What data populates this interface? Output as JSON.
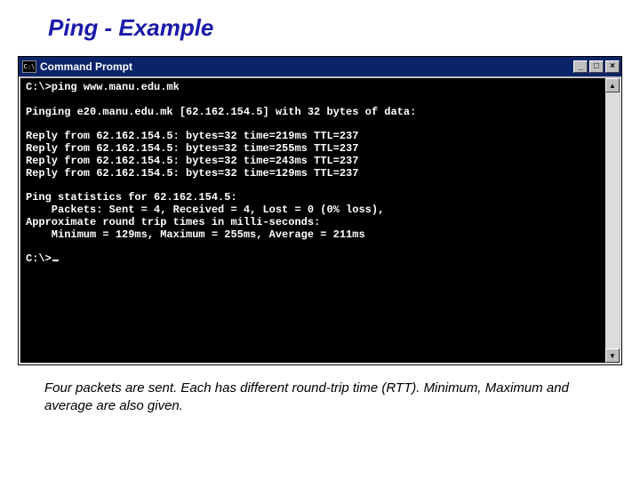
{
  "slide": {
    "title": "Ping - Example",
    "caption": "Four packets are sent. Each has different round-trip time (RTT). Minimum, Maximum and average are also given."
  },
  "window": {
    "title": "Command Prompt",
    "icon_label": "C:\\",
    "buttons": {
      "min": "_",
      "max": "□",
      "close": "×"
    },
    "scrollbar": {
      "up": "▲",
      "down": "▼"
    }
  },
  "console": {
    "prompt1": "C:\\>ping www.manu.edu.mk",
    "blank": "",
    "pinging": "Pinging e20.manu.edu.mk [62.162.154.5] with 32 bytes of data:",
    "reply1": "Reply from 62.162.154.5: bytes=32 time=219ms TTL=237",
    "reply2": "Reply from 62.162.154.5: bytes=32 time=255ms TTL=237",
    "reply3": "Reply from 62.162.154.5: bytes=32 time=243ms TTL=237",
    "reply4": "Reply from 62.162.154.5: bytes=32 time=129ms TTL=237",
    "stats_hdr": "Ping statistics for 62.162.154.5:",
    "stats_pkts": "    Packets: Sent = 4, Received = 4, Lost = 0 (0% loss),",
    "stats_rtt_hdr": "Approximate round trip times in milli-seconds:",
    "stats_rtt": "    Minimum = 129ms, Maximum = 255ms, Average = 211ms",
    "prompt2": "C:\\>"
  }
}
